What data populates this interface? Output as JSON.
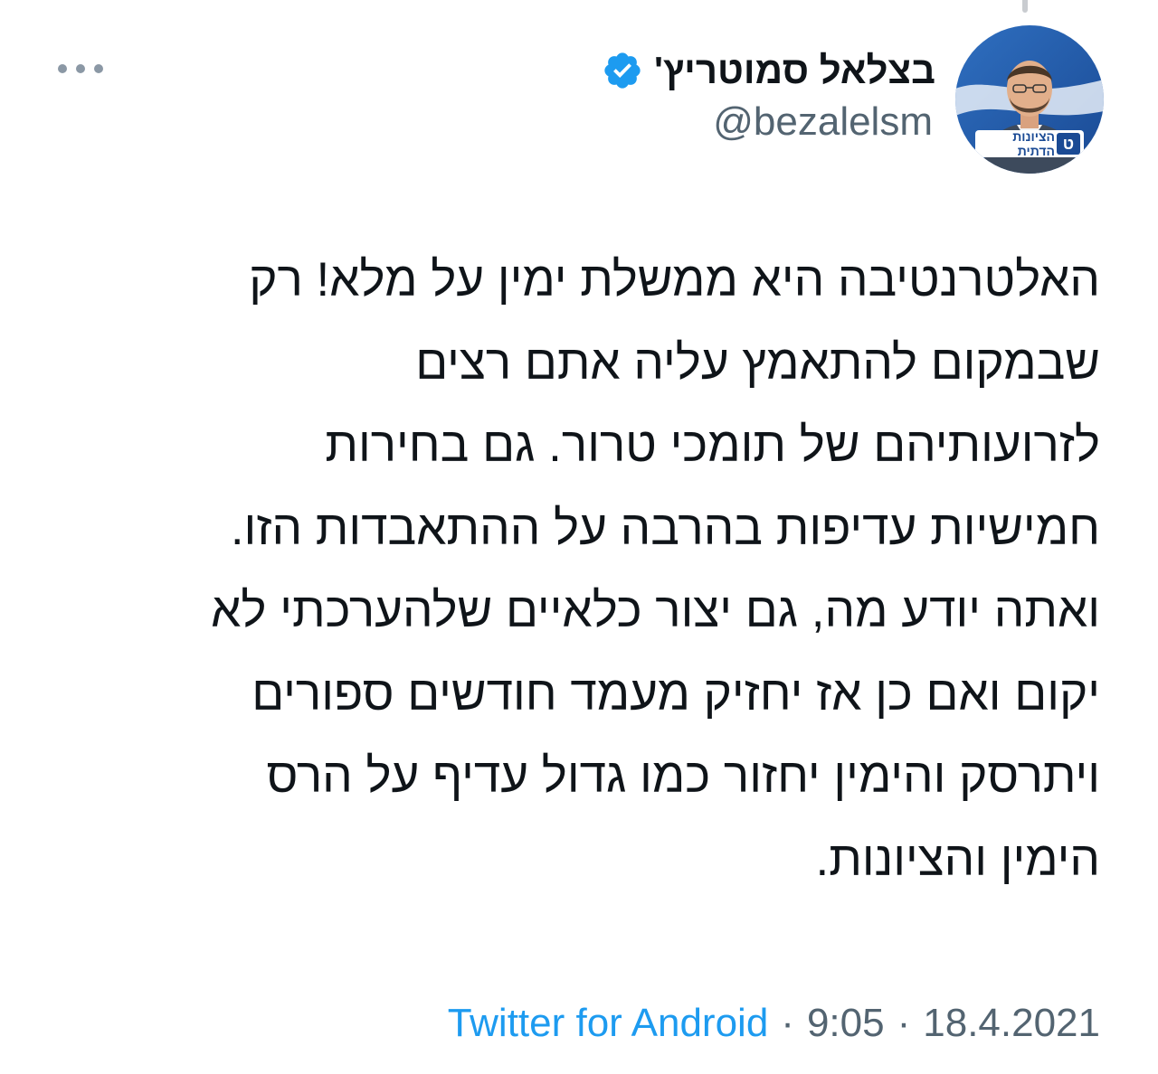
{
  "header": {
    "display_name": "בצלאל סמוטריץ'",
    "handle": "@bezalelsm",
    "verified": true,
    "verified_color": "#1d9bf0",
    "avatar_logo_text": "הציונות הדתית",
    "avatar_logo_letter": "ט",
    "more_icon": "more-horizontal-icon"
  },
  "tweet": {
    "lines": [
      "האלטרנטיבה היא ממשלת ימין על מלא! רק",
      "שבמקום להתאמץ עליה אתם רצים",
      "לזרועותיהם של תומכי טרור. גם בחירות",
      "חמישיות עדיפות בהרבה על ההתאבדות הזו.",
      "ואתה יודע מה, גם יצור כלאיים שלהערכתי לא",
      "יקום ואם כן אז יחזיק מעמד חודשים ספורים",
      "ויתרסק והימין יחזור כמו גדול עדיף על הרס",
      "הימין והציונות."
    ]
  },
  "meta": {
    "source": "Twitter for Android",
    "separator": "·",
    "time": "9:05",
    "date": "18.4.2021"
  },
  "colors": {
    "text": "#0f1419",
    "secondary": "#536471",
    "link": "#1d9bf0"
  }
}
